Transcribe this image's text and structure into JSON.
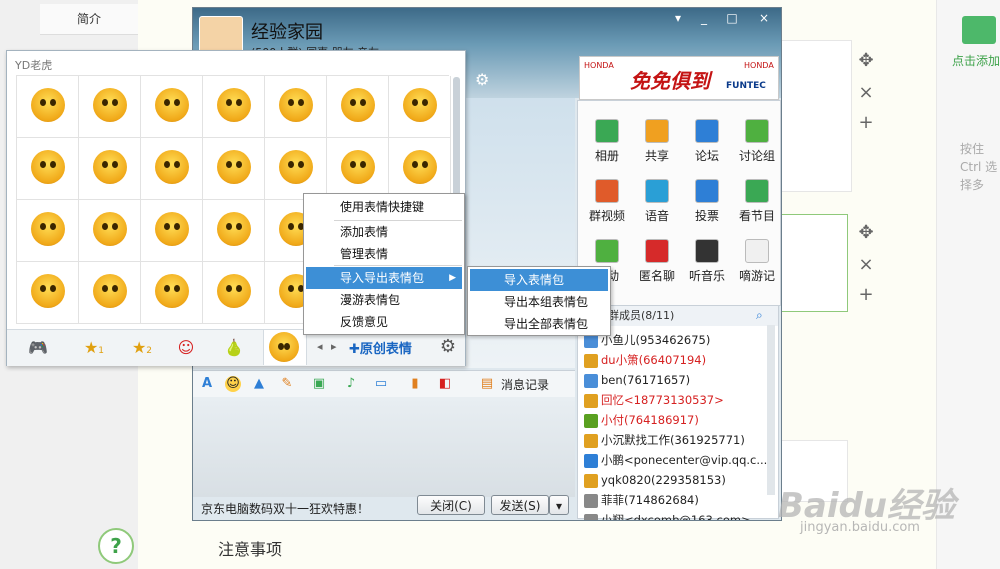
{
  "page": {
    "intro_label": "简介",
    "notice_title": "注意事项",
    "help_glyph": "?",
    "right_panel": {
      "add_image_label": "点击添加",
      "hint": "按住Ctrl 选择多"
    },
    "side_controls": [
      "✥",
      "×",
      "+"
    ]
  },
  "qq_window": {
    "group_name": "经验家园",
    "group_sub": "(500人群) 同事 朋友 亲友",
    "window_buttons": [
      "▾",
      "_",
      "□",
      "×"
    ],
    "ad": {
      "slogan": "免免俱到",
      "brand_left": "HONDA",
      "brand_right": "HONDA",
      "sub_brand": "FUNTEC"
    },
    "apps": [
      {
        "label": "相册",
        "color": "#3aa854"
      },
      {
        "label": "共享",
        "color": "#f0a020"
      },
      {
        "label": "论坛",
        "color": "#2e7fd6"
      },
      {
        "label": "讨论组",
        "color": "#4fb040"
      },
      {
        "label": "群视频",
        "color": "#e05b2a"
      },
      {
        "label": "语音",
        "color": "#2a9fd6"
      },
      {
        "label": "投票",
        "color": "#2e7fd6"
      },
      {
        "label": "看节目",
        "color": "#3aa854"
      },
      {
        "label": "活动",
        "color": "#4fb040"
      },
      {
        "label": "匿名聊",
        "color": "#d62a2a"
      },
      {
        "label": "听音乐",
        "color": "#333333"
      },
      {
        "label": "嘀游记",
        "color": "#f0f0f0"
      }
    ],
    "members_header": "群成员(8/11)",
    "members": [
      {
        "name": "小鱼儿(953462675)",
        "color": "#222222"
      },
      {
        "name": "du小箫(66407194)",
        "color": "#d62020"
      },
      {
        "name": "ben(76171657)",
        "color": "#222222"
      },
      {
        "name": "回忆<18773130537>",
        "color": "#d62020"
      },
      {
        "name": "小付(764186917)",
        "color": "#d62020"
      },
      {
        "name": "小沉默找工作(361925771)",
        "color": "#222222"
      },
      {
        "name": "小鹏<ponecenter@vip.qq.c...",
        "color": "#222222"
      },
      {
        "name": "yqk0820(229358153)",
        "color": "#222222"
      },
      {
        "name": "菲菲(71486268​4)",
        "color": "#222222"
      },
      {
        "name": "小翔<dxcomb@163.com>",
        "color": "#222222"
      }
    ],
    "toolbar": {
      "message_record": "消息记录"
    },
    "footer_text": "京东电脑数码双十一狂欢特惠！",
    "close_button": "关闭(C)",
    "send_button": "发送(S)"
  },
  "emoji_panel": {
    "title": "YD老虎",
    "tabs": [
      {
        "glyph": "🎮",
        "label": ""
      },
      {
        "glyph": "★",
        "label": "1"
      },
      {
        "glyph": "★",
        "label": "2"
      },
      {
        "glyph": "☺",
        "label": ""
      },
      {
        "glyph": "🍐",
        "label": ""
      }
    ],
    "original_label": "✚原创表情",
    "nav": [
      "◂",
      "▸"
    ]
  },
  "context_menu": {
    "items": [
      "使用表情快捷键",
      "添加表情",
      "管理表情",
      "导入导出表情包",
      "漫游表情包",
      "反馈意见"
    ],
    "submenu": [
      "导入表情包",
      "导出本组表情包",
      "导出全部表情包"
    ]
  },
  "watermark": {
    "main": "Baidu经验",
    "sub": "jingyan.baidu.com"
  }
}
